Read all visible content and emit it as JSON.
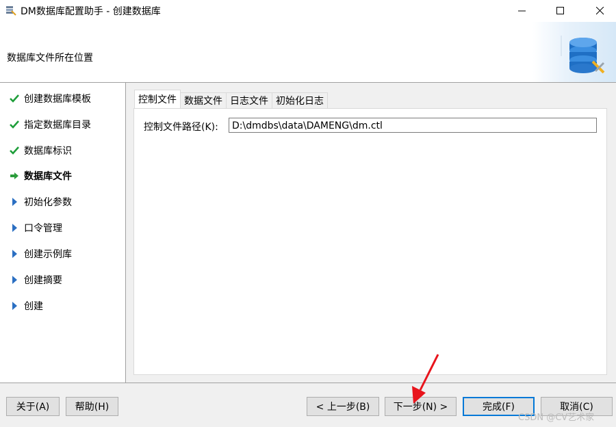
{
  "window": {
    "title": "DM数据库配置助手 - 创建数据库",
    "minimize_label": "—",
    "maximize_label": "☐",
    "close_label": "✕"
  },
  "header": {
    "subtitle": "数据库文件所在位置",
    "icon": "database-tools-icon"
  },
  "steps": [
    {
      "label": "创建数据库模板",
      "state": "done"
    },
    {
      "label": "指定数据库目录",
      "state": "done"
    },
    {
      "label": "数据库标识",
      "state": "done"
    },
    {
      "label": "数据库文件",
      "state": "current"
    },
    {
      "label": "初始化参数",
      "state": "pending"
    },
    {
      "label": "口令管理",
      "state": "pending"
    },
    {
      "label": "创建示例库",
      "state": "pending"
    },
    {
      "label": "创建摘要",
      "state": "pending"
    },
    {
      "label": "创建",
      "state": "pending"
    }
  ],
  "tabs": [
    {
      "label": "控制文件",
      "active": true
    },
    {
      "label": "数据文件",
      "active": false
    },
    {
      "label": "日志文件",
      "active": false
    },
    {
      "label": "初始化日志",
      "active": false
    }
  ],
  "control_file": {
    "path_label": "控制文件路径(K):",
    "path_value": "D:\\dmdbs\\data\\DAMENG\\dm.ctl"
  },
  "footer": {
    "about": "关于(A)",
    "help": "帮助(H)",
    "prev": "< 上一步(B)",
    "next": "下一步(N) >",
    "finish": "完成(F)",
    "cancel": "取消(C)"
  },
  "watermark": "CSDN @CV艺术家",
  "colors": {
    "done": "#1e9e3a",
    "current": "#2b9c3b",
    "pending": "#2b6fc2",
    "accent": "#0078d7",
    "annotation_arrow": "#e8141c"
  }
}
